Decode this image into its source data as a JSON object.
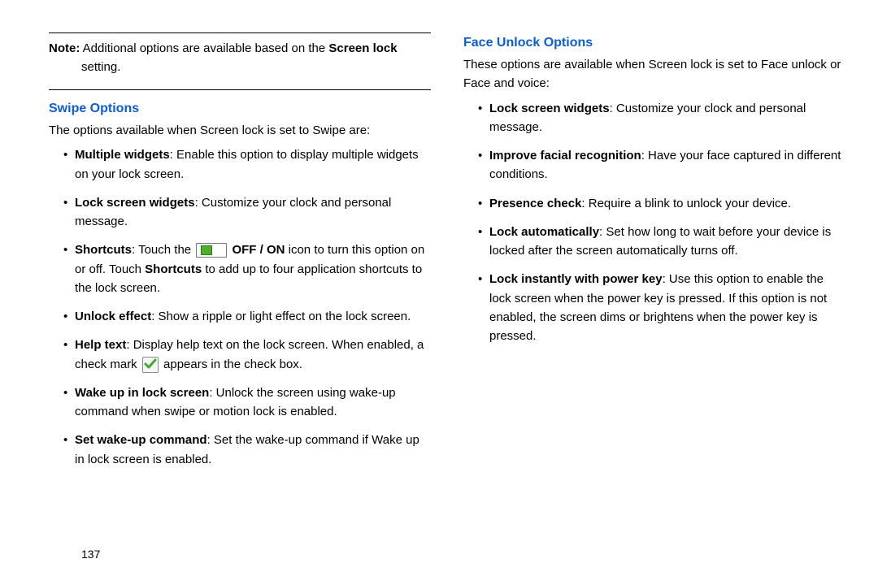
{
  "note": {
    "prefix": "Note:",
    "line1": " Additional options are available based on the ",
    "bold": "Screen lock",
    "line2": "setting."
  },
  "left": {
    "heading": "Swipe Options",
    "intro": "The options available when Screen lock is set to Swipe are:",
    "items": {
      "i0": {
        "b": "Multiple widgets",
        "t": ": Enable this option to display multiple widgets on your lock screen."
      },
      "i1": {
        "b": "Lock screen widgets",
        "t": ": Customize your clock and personal message."
      },
      "i2": {
        "b": "Shortcuts",
        "pre": ": Touch the ",
        "iconlabel": " OFF / ON",
        "mid": " icon to turn this option on or off. Touch ",
        "b2": "Shortcuts",
        "post": " to add up to four application shortcuts to the lock screen."
      },
      "i3": {
        "b": "Unlock effect",
        "t": ": Show a ripple or light effect on the lock screen."
      },
      "i4": {
        "b": "Help text",
        "pre": ": Display help text on the lock screen. When enabled, a check mark ",
        "post": " appears in the check box."
      },
      "i5": {
        "b": "Wake up in lock screen",
        "t": ": Unlock the screen using wake-up command when swipe or motion lock is enabled."
      },
      "i6": {
        "b": "Set wake-up command",
        "t": ": Set the wake-up command if Wake up in lock screen is enabled."
      }
    }
  },
  "right": {
    "heading": "Face Unlock Options",
    "intro": "These options are available when Screen lock is set to Face unlock or Face and voice:",
    "items": {
      "i0": {
        "b": "Lock screen widgets",
        "t": ": Customize your clock and personal message."
      },
      "i1": {
        "b": "Improve facial recognition",
        "t": ": Have your face captured in different conditions."
      },
      "i2": {
        "b": "Presence check",
        "t": ": Require a blink to unlock your device."
      },
      "i3": {
        "b": "Lock automatically",
        "t": ": Set how long to wait before your device is locked after the screen automatically turns off."
      },
      "i4": {
        "b": "Lock instantly with power key",
        "t": ": Use this option to enable the lock screen when the power key is pressed. If this option is not enabled, the screen dims or brightens when the power key is pressed."
      }
    }
  },
  "page_number": "137"
}
